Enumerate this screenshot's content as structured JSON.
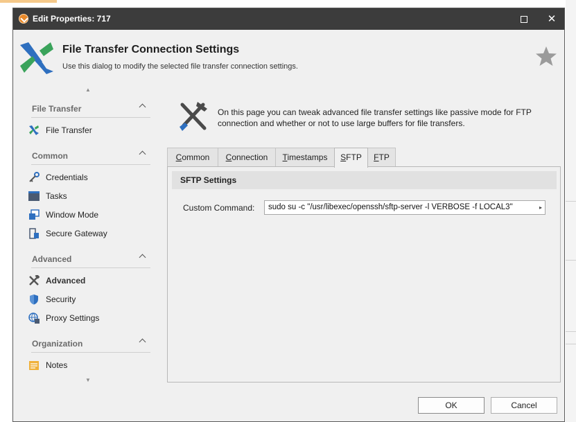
{
  "window": {
    "title": "Edit Properties: 717",
    "close_glyph": "✕"
  },
  "header": {
    "title": "File Transfer Connection Settings",
    "subtitle": "Use this dialog to modify the selected file transfer connection settings.",
    "logo_colors": [
      "#2e6fbf",
      "#3aa35b"
    ],
    "favorite_icon": "star-icon"
  },
  "sidebar": {
    "scroll_up": "▲",
    "scroll_down": "▼",
    "sections": [
      {
        "label": "File Transfer",
        "items": [
          {
            "label": "File Transfer",
            "icon": "file-transfer-icon"
          }
        ]
      },
      {
        "label": "Common",
        "items": [
          {
            "label": "Credentials",
            "icon": "key-icon"
          },
          {
            "label": "Tasks",
            "icon": "tasks-icon"
          },
          {
            "label": "Window Mode",
            "icon": "window-mode-icon"
          },
          {
            "label": "Secure Gateway",
            "icon": "gateway-icon"
          }
        ]
      },
      {
        "label": "Advanced",
        "items": [
          {
            "label": "Advanced",
            "icon": "tools-icon",
            "active": true
          },
          {
            "label": "Security",
            "icon": "shield-icon"
          },
          {
            "label": "Proxy Settings",
            "icon": "globe-icon"
          }
        ]
      },
      {
        "label": "Organization",
        "items": [
          {
            "label": "Notes",
            "icon": "notes-icon"
          }
        ]
      }
    ]
  },
  "info": {
    "text": "On this page you can tweak advanced file transfer settings like passive mode for FTP connection and whether or not to use large buffers for file transfers.",
    "icon": "tools-icon"
  },
  "tabs": [
    {
      "label": "Common",
      "accel": "C",
      "rest": "ommon"
    },
    {
      "label": "Connection",
      "accel": "C",
      "rest": "onnection"
    },
    {
      "label": "Timestamps",
      "accel": "T",
      "rest": "imestamps"
    },
    {
      "label": "SFTP",
      "accel": "S",
      "rest": "FTP",
      "active": true
    },
    {
      "label": "FTP",
      "accel": "F",
      "rest": "TP"
    }
  ],
  "sftp": {
    "heading": "SFTP Settings",
    "custom_command_label": "Custom Command:",
    "custom_command_value": "sudo su -c \"/usr/libexec/openssh/sftp-server -l VERBOSE -f LOCAL3\"",
    "expand_glyph": "▸"
  },
  "buttons": {
    "ok": "OK",
    "cancel": "Cancel"
  },
  "colors": {
    "titlebar": "#3c3c3c",
    "dialog_bg": "#f0f0f0",
    "accent_orange": "#e8892b"
  }
}
